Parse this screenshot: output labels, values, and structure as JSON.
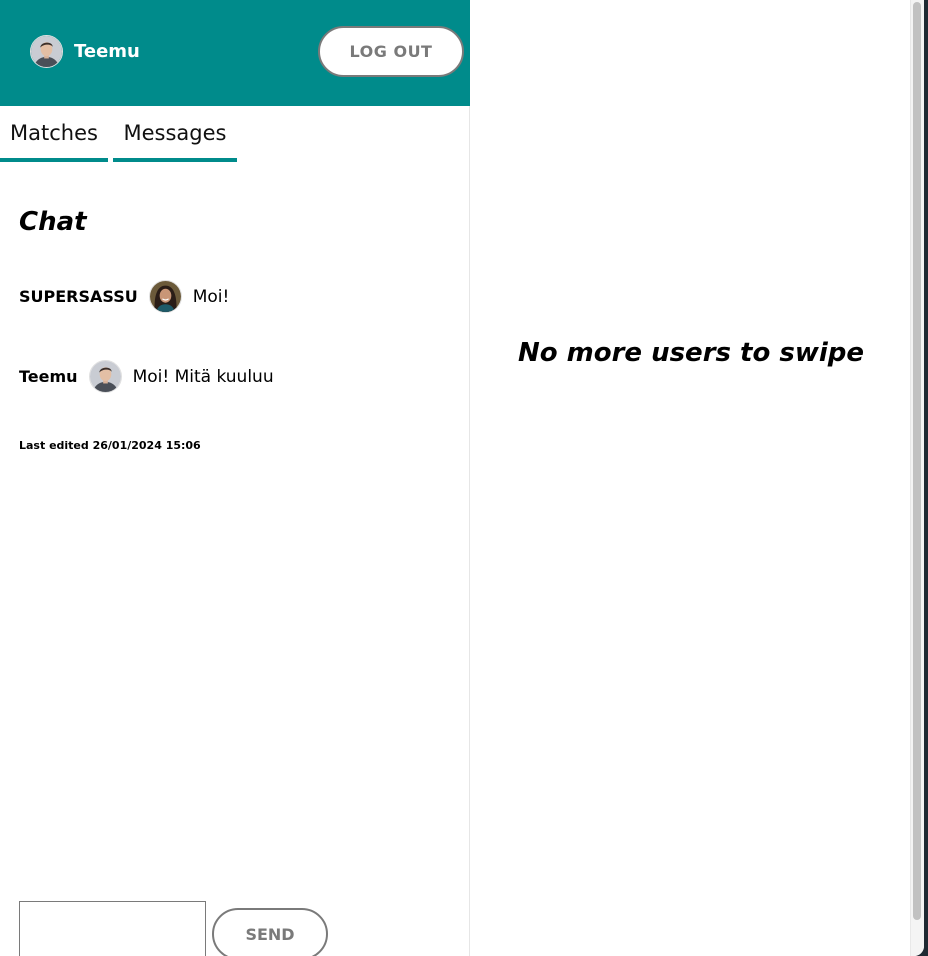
{
  "header": {
    "user_name": "Teemu",
    "logout_label": "LOG OUT"
  },
  "tabs": [
    {
      "label": "Matches"
    },
    {
      "label": "Messages"
    }
  ],
  "chat": {
    "title": "Chat",
    "messages": [
      {
        "author": "SUPERSASSU",
        "text": "Moi!"
      },
      {
        "author": "Teemu",
        "text": "Moi! Mitä kuuluu"
      }
    ],
    "last_edited": "Last edited 26/01/2024 15:06"
  },
  "composer": {
    "input_value": "",
    "send_label": "SEND"
  },
  "swipe": {
    "empty_message": "No more users to swipe"
  },
  "colors": {
    "header_bg": "#008b8b",
    "tab_underline": "#008b8b",
    "button_border": "#7a7a7a"
  },
  "icons": [
    "avatar-teemu",
    "avatar-supersassu"
  ]
}
